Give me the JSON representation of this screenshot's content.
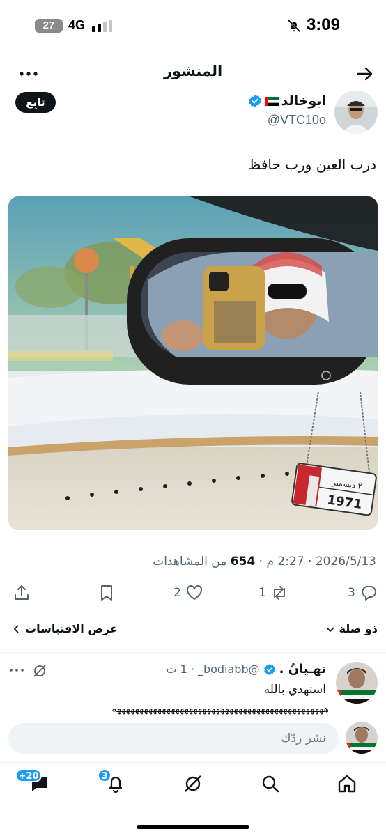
{
  "status_bar": {
    "time": "3:09",
    "network": "4G",
    "battery": "27"
  },
  "header": {
    "title": "المنشور"
  },
  "author": {
    "name": "ابوخالد",
    "handle": "@VTC10o",
    "follow_label": "تابِع"
  },
  "post": {
    "text": "درب العين ورب حافظ",
    "date": "2026/5/13",
    "time": "2:27 م",
    "views_count": "654",
    "views_label": "من المشاهدات",
    "plate_top": "٢ ديسمبر",
    "plate_number": "1971"
  },
  "actions": {
    "replies": "3",
    "reposts": "1",
    "likes": "2"
  },
  "reply_settings": {
    "label": "ذو صلة",
    "quotes_label": "عرض الاقتباسات"
  },
  "reply": {
    "name": "نهـيانُ .",
    "handle": "@bodiabb_",
    "age": "1 ث",
    "text": "استهدي بالله",
    "tail": "هههههههههههههههههههههههههههههههههههههههههههههههه"
  },
  "composer": {
    "placeholder": "نشر ردّك"
  },
  "bottom_nav": {
    "messages_badge": "+20",
    "notifications_badge": "3"
  },
  "colors": {
    "accent": "#1d9bf0",
    "text": "#0f1419",
    "secondary": "#536471"
  }
}
